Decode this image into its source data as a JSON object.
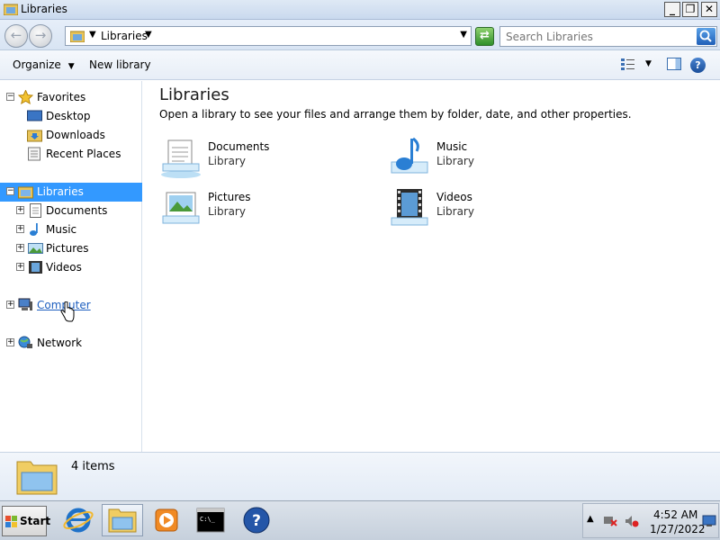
{
  "window": {
    "title": "Libraries",
    "minimize": "_",
    "maximize": "❐",
    "close": "✕"
  },
  "address": {
    "crumb": "Libraries",
    "search_placeholder": "Search Libraries"
  },
  "toolbar": {
    "organize": "Organize",
    "new_library": "New library",
    "help": "?"
  },
  "nav": {
    "favorites": {
      "label": "Favorites",
      "items": [
        "Desktop",
        "Downloads",
        "Recent Places"
      ]
    },
    "libraries": {
      "label": "Libraries",
      "items": [
        "Documents",
        "Music",
        "Pictures",
        "Videos"
      ]
    },
    "computer": "Computer",
    "network": "Network"
  },
  "content": {
    "heading": "Libraries",
    "description": "Open a library to see your files and arrange them by folder, date, and other properties.",
    "libraries": [
      {
        "name": "Documents",
        "type": "Library",
        "icon": "documents-icon"
      },
      {
        "name": "Music",
        "type": "Library",
        "icon": "music-icon"
      },
      {
        "name": "Pictures",
        "type": "Library",
        "icon": "pictures-icon"
      },
      {
        "name": "Videos",
        "type": "Library",
        "icon": "videos-icon"
      }
    ]
  },
  "details": {
    "count": "4 items"
  },
  "taskbar": {
    "start": "Start",
    "cmd_text": "C:\\_",
    "help": "?",
    "time": "4:52 AM",
    "date": "1/27/2022"
  }
}
